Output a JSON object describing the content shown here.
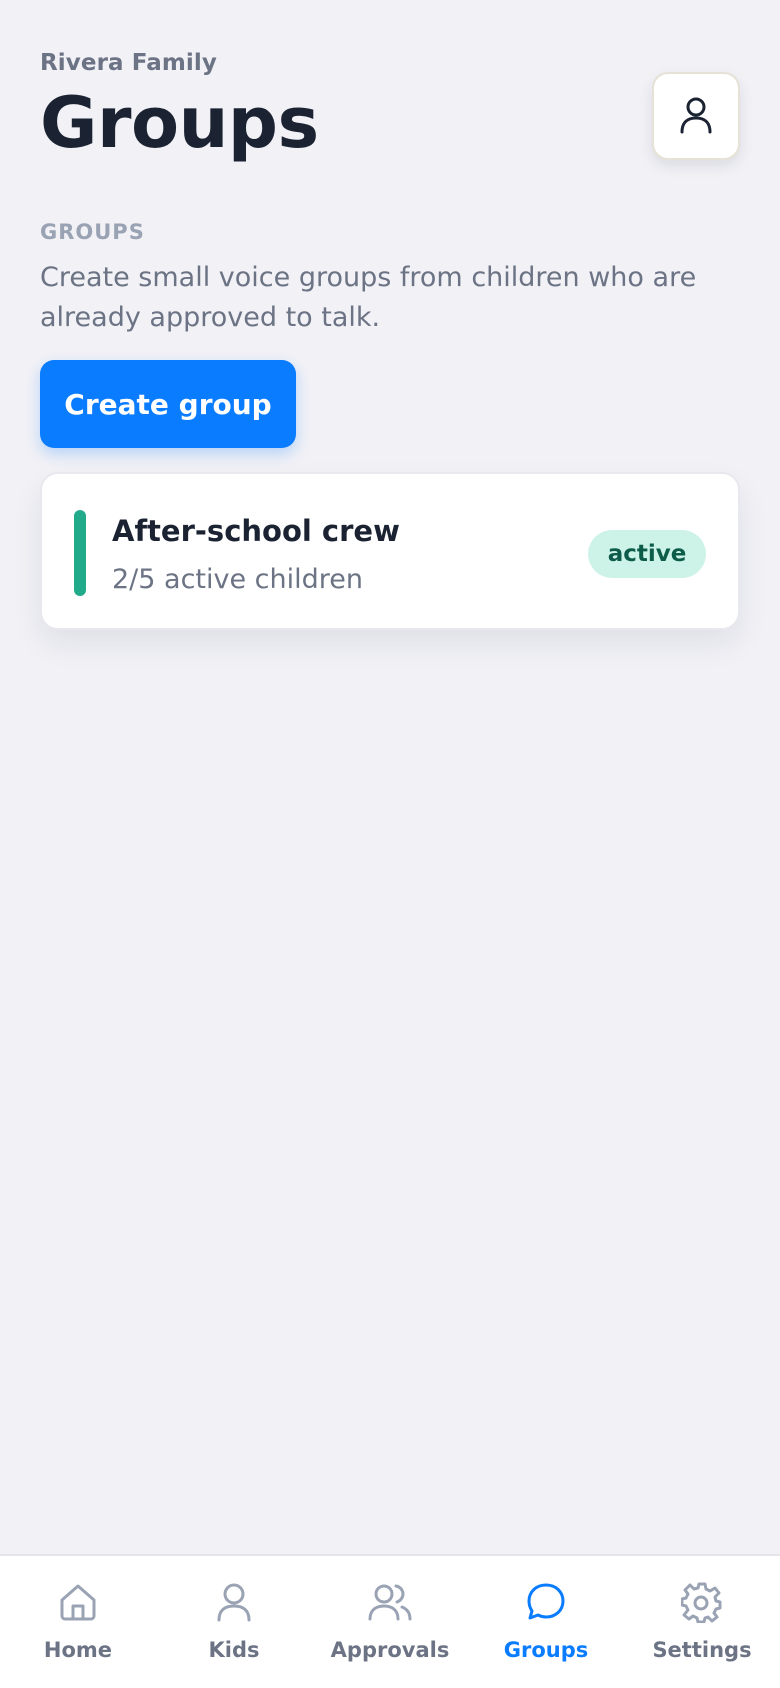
{
  "header": {
    "family_name": "Rivera Family",
    "title": "Groups",
    "profile_icon": "user-icon"
  },
  "section": {
    "label": "GROUPS",
    "description": "Create small voice groups from children who are already approved to talk."
  },
  "actions": {
    "create_group_label": "Create group"
  },
  "groups": [
    {
      "name": "After-school crew",
      "meta": "2/5 active children",
      "status": "active",
      "accent_color": "#22ab8b"
    }
  ],
  "tabbar": {
    "active_color": "#0a7cff",
    "inactive_color": "#6b7384",
    "tabs": [
      {
        "label": "Home",
        "icon": "home-icon",
        "active": false
      },
      {
        "label": "Kids",
        "icon": "user-icon",
        "active": false
      },
      {
        "label": "Approvals",
        "icon": "users-icon",
        "active": false
      },
      {
        "label": "Groups",
        "icon": "chat-bubble-icon",
        "active": true
      },
      {
        "label": "Settings",
        "icon": "gear-icon",
        "active": false
      }
    ]
  }
}
